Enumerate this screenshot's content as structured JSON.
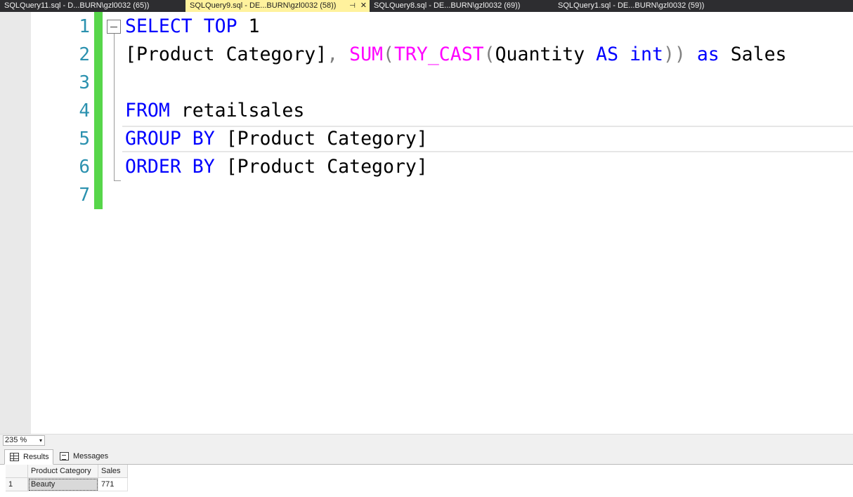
{
  "tabs": [
    {
      "label": "SQLQuery11.sql - D...BURN\\gzl0032 (65))",
      "active": false
    },
    {
      "label": "SQLQuery9.sql - DE...BURN\\gzl0032 (58))",
      "active": true,
      "pin_glyph": "⊣",
      "close_glyph": "✕"
    },
    {
      "label": "SQLQuery8.sql - DE...BURN\\gzl0032 (69))",
      "active": false
    },
    {
      "label": "SQLQuery1.sql - DE...BURN\\gzl0032 (59))",
      "active": false
    }
  ],
  "editor": {
    "line_numbers": [
      "1",
      "2",
      "3",
      "4",
      "5",
      "6",
      "7"
    ],
    "lines": [
      [
        {
          "t": "SELECT",
          "c": "kw"
        },
        {
          "t": " ",
          "c": "plain"
        },
        {
          "t": "TOP",
          "c": "kw"
        },
        {
          "t": " 1",
          "c": "plain"
        }
      ],
      [
        {
          "t": "[Product Category]",
          "c": "plain"
        },
        {
          "t": ",",
          "c": "op"
        },
        {
          "t": " ",
          "c": "plain"
        },
        {
          "t": "SUM",
          "c": "fn"
        },
        {
          "t": "(",
          "c": "op"
        },
        {
          "t": "TRY_CAST",
          "c": "fn"
        },
        {
          "t": "(",
          "c": "op"
        },
        {
          "t": "Quantity ",
          "c": "plain"
        },
        {
          "t": "AS",
          "c": "kw"
        },
        {
          "t": " ",
          "c": "plain"
        },
        {
          "t": "int",
          "c": "kw"
        },
        {
          "t": "))",
          "c": "op"
        },
        {
          "t": " ",
          "c": "plain"
        },
        {
          "t": "as",
          "c": "kw"
        },
        {
          "t": " Sales",
          "c": "plain"
        }
      ],
      [],
      [
        {
          "t": "FROM",
          "c": "kw"
        },
        {
          "t": " retailsales",
          "c": "plain"
        }
      ],
      [
        {
          "t": "GROUP",
          "c": "kw"
        },
        {
          "t": " ",
          "c": "plain"
        },
        {
          "t": "BY",
          "c": "kw"
        },
        {
          "t": " [Product Category]",
          "c": "plain"
        }
      ],
      [
        {
          "t": "ORDER",
          "c": "kw"
        },
        {
          "t": " ",
          "c": "plain"
        },
        {
          "t": "BY",
          "c": "kw"
        },
        {
          "t": " [Product Category]",
          "c": "plain"
        }
      ],
      []
    ],
    "colors": {
      "keyword": "#0000ff",
      "function": "#ff00ff",
      "operator": "#808080",
      "line_number": "#2b91af",
      "change_bar": "#57d64a"
    }
  },
  "zoom": {
    "value": "235 %",
    "arrow_glyph": "▾"
  },
  "results": {
    "tabs": [
      {
        "label": "Results",
        "icon": "grid-icon",
        "active": true
      },
      {
        "label": "Messages",
        "icon": "messages-icon",
        "active": false
      }
    ],
    "columns": [
      "",
      "Product Category",
      "Sales"
    ],
    "rows": [
      [
        "1",
        "Beauty",
        "771"
      ]
    ]
  }
}
